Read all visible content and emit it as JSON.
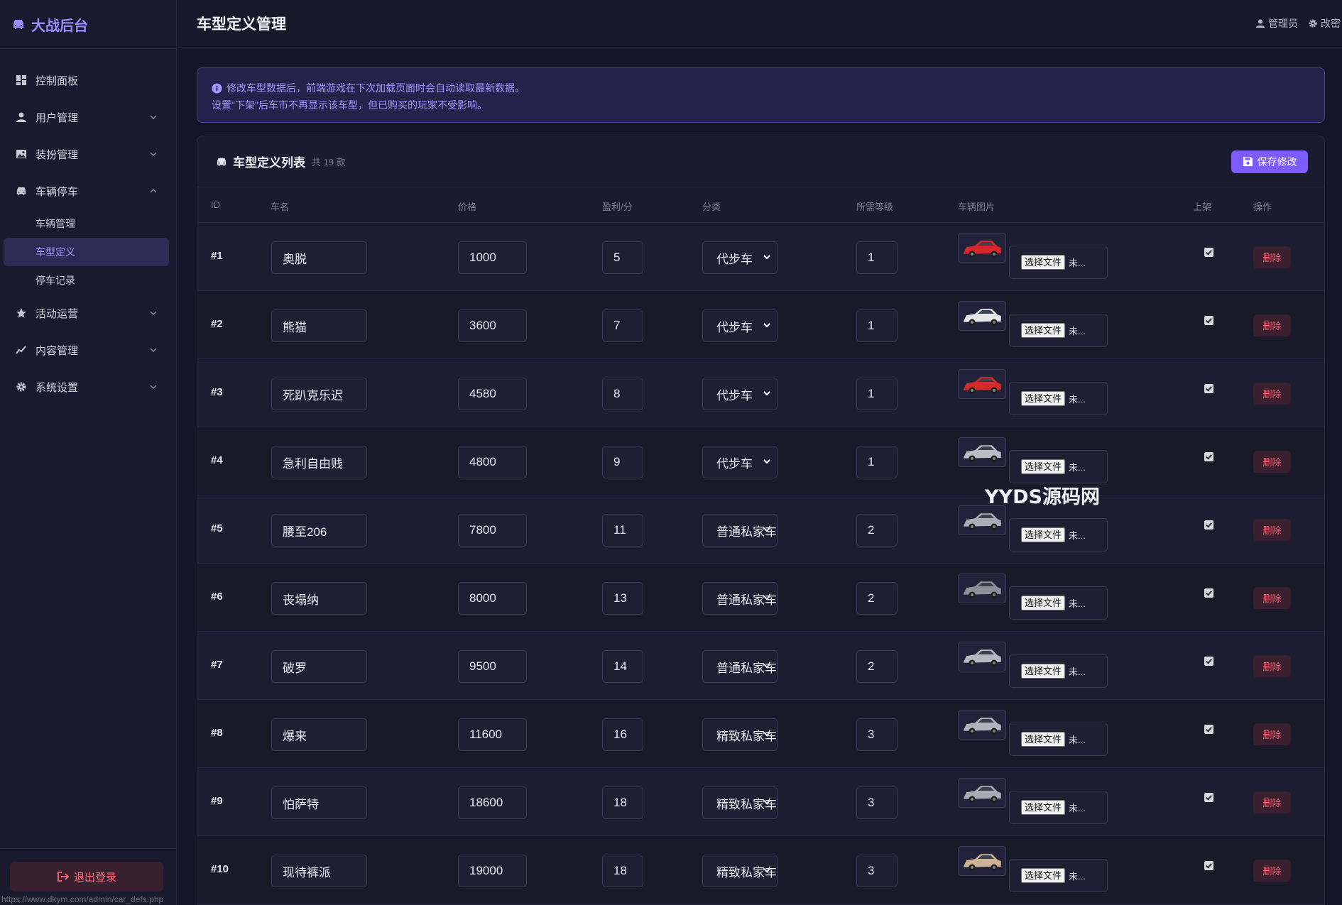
{
  "brand": {
    "title": "大战后台"
  },
  "sidebar": {
    "items": [
      {
        "label": "控制面板",
        "icon": "dashboard-icon"
      },
      {
        "label": "用户管理",
        "icon": "user-icon"
      },
      {
        "label": "装扮管理",
        "icon": "image-icon"
      },
      {
        "label": "车辆停车",
        "icon": "car-icon"
      },
      {
        "label": "活动运营",
        "icon": "star-icon"
      },
      {
        "label": "内容管理",
        "icon": "chart-line-icon"
      },
      {
        "label": "系统设置",
        "icon": "gear-icon"
      }
    ],
    "sub_items": [
      {
        "label": "车辆管理"
      },
      {
        "label": "车型定义",
        "active": true
      },
      {
        "label": "停车记录"
      }
    ],
    "logout_label": "退出登录",
    "status_url": "https://www.dkym.com/admin/car_defs.php"
  },
  "header": {
    "title": "车型定义管理",
    "user_label": "管理员",
    "password_label": "改密"
  },
  "notice": {
    "line1": "修改车型数据后，前端游戏在下次加载页面时会自动读取最新数据。",
    "line2": "设置\"下架\"后车市不再显示该车型，但已购买的玩家不受影响。"
  },
  "card": {
    "title": "车型定义列表",
    "count": "共 19 款",
    "save_label": "保存修改"
  },
  "table": {
    "columns": [
      "ID",
      "车名",
      "价格",
      "盈利/分",
      "分类",
      "所需等级",
      "车辆图片",
      "上架",
      "操作"
    ],
    "file_button": "选择文件",
    "file_status": "未...",
    "delete_label": "删除",
    "rows": [
      {
        "id": "#1",
        "name": "奥脱",
        "price": "1000",
        "profit": "5",
        "category": "代步车",
        "level": "1",
        "car_color": "#d8262a"
      },
      {
        "id": "#2",
        "name": "熊猫",
        "price": "3600",
        "profit": "7",
        "category": "代步车",
        "level": "1",
        "car_color": "#e6e6ea"
      },
      {
        "id": "#3",
        "name": "死趴克乐迟",
        "price": "4580",
        "profit": "8",
        "category": "代步车",
        "level": "1",
        "car_color": "#d52a2a"
      },
      {
        "id": "#4",
        "name": "急利自由贱",
        "price": "4800",
        "profit": "9",
        "category": "代步车",
        "level": "1",
        "car_color": "#b9bcc4"
      },
      {
        "id": "#5",
        "name": "腰至206",
        "price": "7800",
        "profit": "11",
        "category": "普通私家车",
        "level": "2",
        "car_color": "#a9adb5"
      },
      {
        "id": "#6",
        "name": "丧塌纳",
        "price": "8000",
        "profit": "13",
        "category": "普通私家车",
        "level": "2",
        "car_color": "#8d9099"
      },
      {
        "id": "#7",
        "name": "破罗",
        "price": "9500",
        "profit": "14",
        "category": "普通私家车",
        "level": "2",
        "car_color": "#b4b7bf"
      },
      {
        "id": "#8",
        "name": "爆来",
        "price": "11600",
        "profit": "16",
        "category": "精致私家车",
        "level": "3",
        "car_color": "#b0b3bb"
      },
      {
        "id": "#9",
        "name": "怕萨特",
        "price": "18600",
        "profit": "18",
        "category": "精致私家车",
        "level": "3",
        "car_color": "#a7abb3"
      },
      {
        "id": "#10",
        "name": "现待裤派",
        "price": "19000",
        "profit": "18",
        "category": "精致私家车",
        "level": "3",
        "car_color": "#cdb293"
      }
    ]
  },
  "watermark": "YYDS源码网",
  "colors": {
    "accent": "#7c5cff",
    "danger": "#ff5a6e",
    "background": "#141528"
  }
}
